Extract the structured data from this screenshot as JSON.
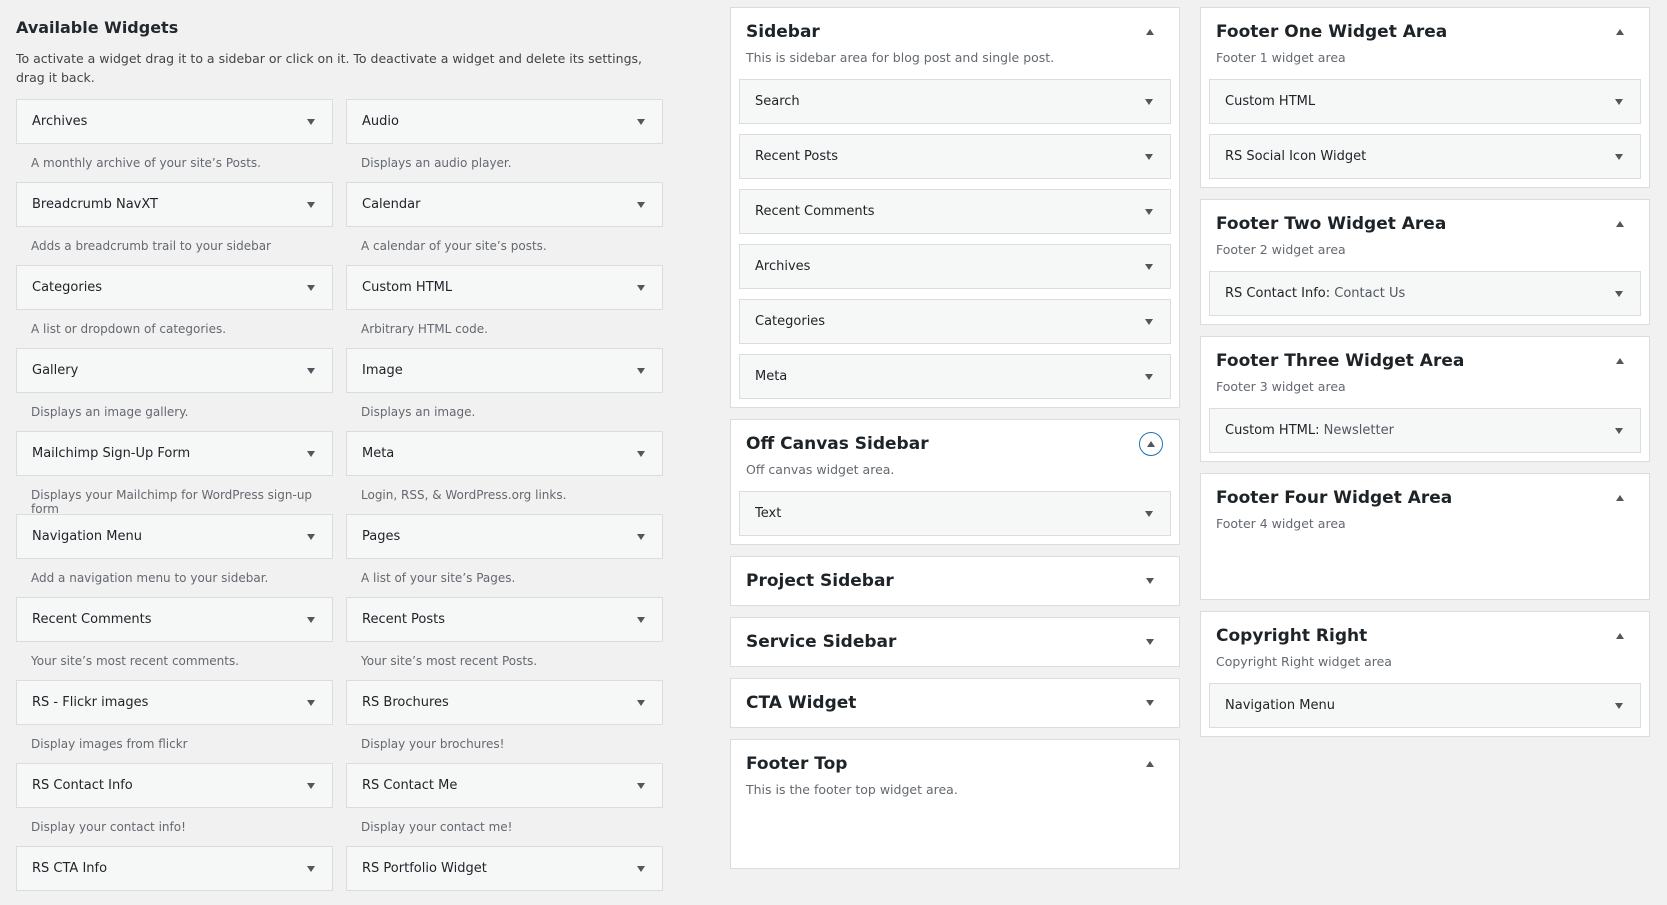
{
  "available": {
    "title": "Available Widgets",
    "description": "To activate a widget drag it to a sidebar or click on it. To deactivate a widget and delete its settings, drag it back.",
    "widgets": [
      {
        "title": "Archives",
        "desc": "A monthly archive of your site’s Posts."
      },
      {
        "title": "Audio",
        "desc": "Displays an audio player."
      },
      {
        "title": "Breadcrumb NavXT",
        "desc": "Adds a breadcrumb trail to your sidebar"
      },
      {
        "title": "Calendar",
        "desc": "A calendar of your site’s posts."
      },
      {
        "title": "Categories",
        "desc": "A list or dropdown of categories."
      },
      {
        "title": "Custom HTML",
        "desc": "Arbitrary HTML code."
      },
      {
        "title": "Gallery",
        "desc": "Displays an image gallery."
      },
      {
        "title": "Image",
        "desc": "Displays an image."
      },
      {
        "title": "Mailchimp Sign-Up Form",
        "desc": "Displays your Mailchimp for WordPress sign-up form"
      },
      {
        "title": "Meta",
        "desc": "Login, RSS, & WordPress.org links."
      },
      {
        "title": "Navigation Menu",
        "desc": "Add a navigation menu to your sidebar."
      },
      {
        "title": "Pages",
        "desc": "A list of your site’s Pages."
      },
      {
        "title": "Recent Comments",
        "desc": "Your site’s most recent comments."
      },
      {
        "title": "Recent Posts",
        "desc": "Your site’s most recent Posts."
      },
      {
        "title": "RS - Flickr images",
        "desc": "Display images from flickr"
      },
      {
        "title": "RS Brochures",
        "desc": "Display your brochures!"
      },
      {
        "title": "RS Contact Info",
        "desc": "Display your contact info!"
      },
      {
        "title": "RS Contact Me",
        "desc": "Display your contact me!"
      },
      {
        "title": "RS CTA Info",
        "desc": ""
      },
      {
        "title": "RS Portfolio Widget",
        "desc": ""
      }
    ]
  },
  "sidebar": {
    "title": "Sidebar",
    "desc": "This is sidebar area for blog post and single post.",
    "widgets": [
      "Search",
      "Recent Posts",
      "Recent Comments",
      "Archives",
      "Categories",
      "Meta"
    ]
  },
  "off_canvas": {
    "title": "Off Canvas Sidebar",
    "desc": "Off canvas widget area.",
    "widgets": [
      "Text"
    ]
  },
  "project_sidebar": {
    "title": "Project Sidebar"
  },
  "service_sidebar": {
    "title": "Service Sidebar"
  },
  "cta_widget": {
    "title": "CTA Widget"
  },
  "footer_top": {
    "title": "Footer Top",
    "desc": "This is the footer top widget area."
  },
  "footer_one": {
    "title": "Footer One Widget Area",
    "desc": "Footer 1 widget area",
    "widgets": [
      "Custom HTML",
      "RS Social Icon Widget"
    ]
  },
  "footer_two": {
    "title": "Footer Two Widget Area",
    "desc": "Footer 2 widget area",
    "widget_name": "RS Contact Info:",
    "widget_sub": "Contact Us"
  },
  "footer_three": {
    "title": "Footer Three Widget Area",
    "desc": "Footer 3 widget area",
    "widget_name": "Custom HTML:",
    "widget_sub": "Newsletter"
  },
  "footer_four": {
    "title": "Footer Four Widget Area",
    "desc": "Footer 4 widget area"
  },
  "copyright_right": {
    "title": "Copyright Right",
    "desc": "Copyright Right widget area",
    "widgets": [
      "Navigation Menu"
    ]
  }
}
